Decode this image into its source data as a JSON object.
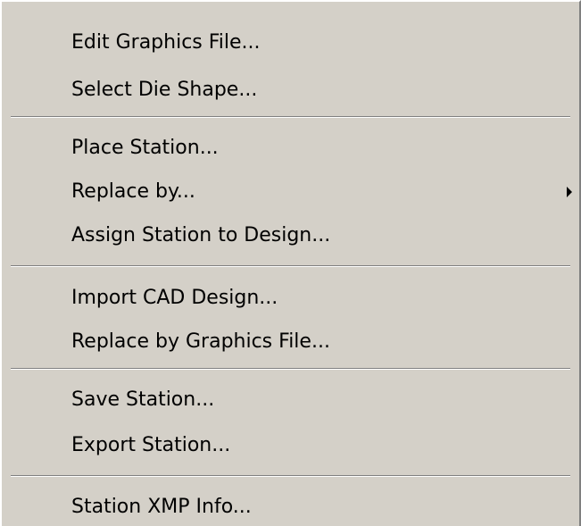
{
  "context_menu": {
    "groups": [
      {
        "items": [
          {
            "label": "Edit Graphics File..."
          },
          {
            "label": "Select Die Shape..."
          }
        ]
      },
      {
        "items": [
          {
            "label": "Place Station..."
          },
          {
            "label": "Replace by...",
            "has_submenu": true,
            "submenu_icon": "chevron-right-icon"
          },
          {
            "label": "Assign Station to Design..."
          }
        ]
      },
      {
        "items": [
          {
            "label": "Import CAD Design..."
          },
          {
            "label": "Replace by Graphics File..."
          }
        ]
      },
      {
        "items": [
          {
            "label": "Save Station..."
          },
          {
            "label": "Export Station..."
          }
        ]
      },
      {
        "items": [
          {
            "label": "Station XMP Info..."
          }
        ]
      }
    ],
    "colors": {
      "background": "#d4d0c8",
      "text": "#000000",
      "separator_dark": "#808080",
      "separator_light": "#ffffff",
      "highlight": "#0a246a"
    }
  }
}
